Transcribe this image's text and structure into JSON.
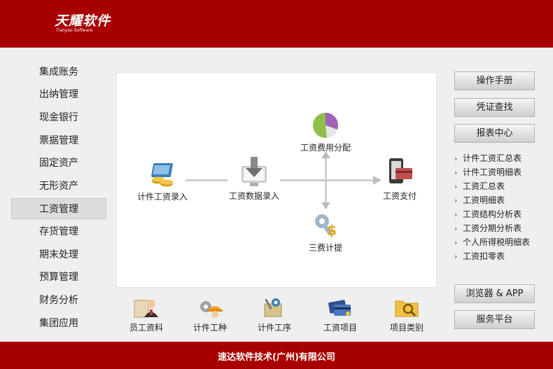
{
  "header": {
    "logo_cn": "天耀软件",
    "logo_en": "Tianyao Software"
  },
  "sidebar": {
    "items": [
      {
        "label": "集成账务"
      },
      {
        "label": "出纳管理"
      },
      {
        "label": "现金银行"
      },
      {
        "label": "票据管理"
      },
      {
        "label": "固定资产"
      },
      {
        "label": "无形资产"
      },
      {
        "label": "工资管理",
        "active": true
      },
      {
        "label": "存货管理"
      },
      {
        "label": "期末处理"
      },
      {
        "label": "预算管理"
      },
      {
        "label": "财务分析"
      },
      {
        "label": "集团应用"
      }
    ]
  },
  "flow": {
    "piece_entry": "计件工资录入",
    "salary_entry": "工资数据录入",
    "expense_alloc": "工资费用分配",
    "three_fees": "三费计提",
    "payment": "工资支付"
  },
  "bottom": {
    "employee": "员工资料",
    "piece_type": "计件工种",
    "piece_process": "计件工序",
    "salary_items": "工资项目",
    "item_category": "项目类别"
  },
  "right": {
    "manual": "操作手册",
    "voucher": "凭证查找",
    "report_center": "报表中心",
    "reports": [
      "计件工资汇总表",
      "计件工资明细表",
      "工资汇总表",
      "工资明细表",
      "工资结构分析表",
      "工资分期分析表",
      "个人所得税明细表",
      "工资扣零表"
    ],
    "browser": "浏览器 & APP",
    "service": "服务平台"
  },
  "footer": {
    "company": "速达软件技术(广州)有限公司"
  },
  "colors": {
    "brand_red": "#a80000",
    "panel_bg": "#efefef"
  }
}
